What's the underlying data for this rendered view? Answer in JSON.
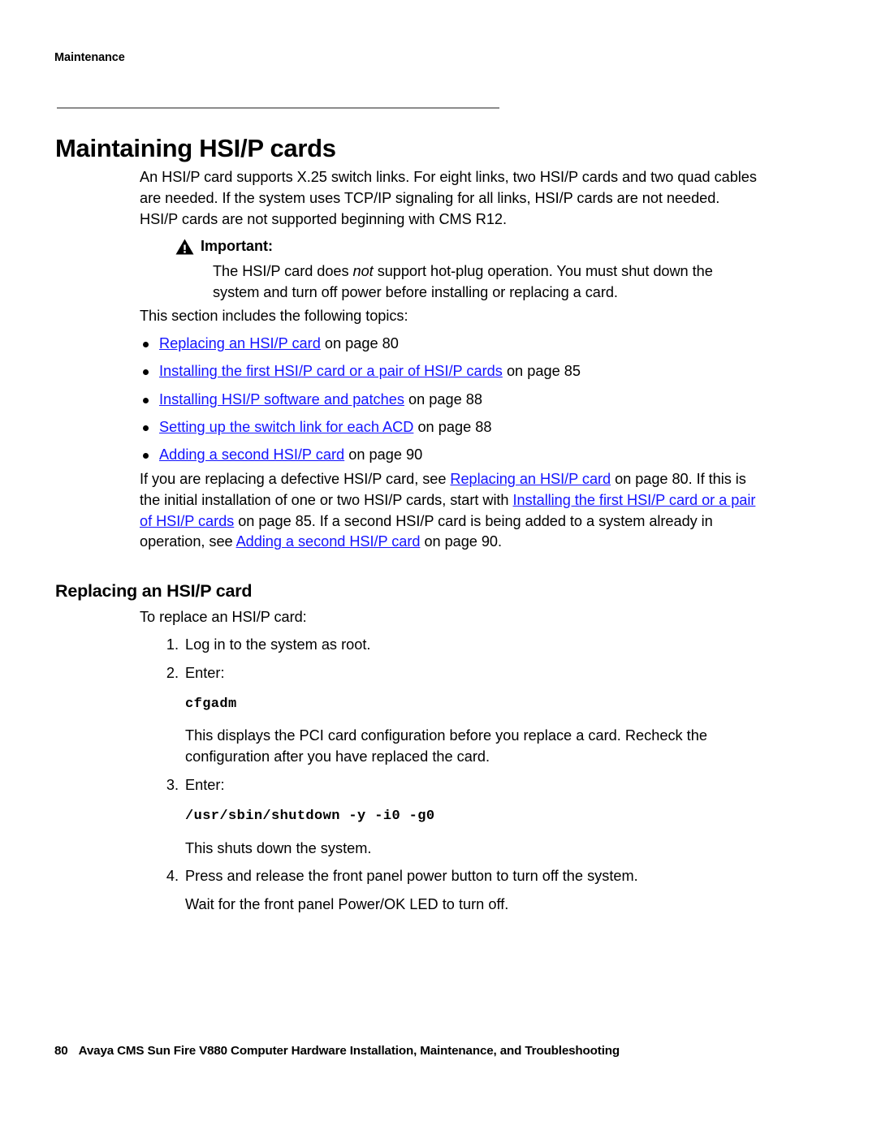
{
  "document": {
    "running_header": "Maintenance",
    "chapter_title": "Maintaining HSI/P cards",
    "footer": {
      "page_number": "80",
      "title": "Avaya CMS Sun Fire V880 Computer Hardware Installation, Maintenance, and Troubleshooting"
    }
  },
  "intro": {
    "paragraph": "An HSI/P card supports X.25 switch links. For eight links, two HSI/P cards and two quad cables are needed. If the system uses TCP/IP signaling for all links, HSI/P cards are not needed. HSI/P cards are not supported beginning with CMS R12."
  },
  "important": {
    "icon": "warning-triangle-icon",
    "label": "Important:",
    "text_before_emphasis": "The HSI/P card does ",
    "emphasis": "not",
    "text_after_emphasis": " support hot-plug operation. You must shut down the system and turn off power before installing or replacing a card."
  },
  "topics": {
    "lead_in": "This section includes the following topics:",
    "items": [
      {
        "link": "Replacing an HSI/P card",
        "suffix": " on page 80"
      },
      {
        "link": "Installing the first HSI/P card or a pair of HSI/P cards",
        "suffix": " on page 85"
      },
      {
        "link": "Installing HSI/P software and patches",
        "suffix": " on page 88"
      },
      {
        "link": "Setting up the switch link for each ACD",
        "suffix": " on page 88"
      },
      {
        "link": "Adding a second HSI/P card",
        "suffix": " on page 90"
      }
    ]
  },
  "guidance": {
    "seg1": "If you are replacing a defective HSI/P card, see ",
    "link1": "Replacing an HSI/P card",
    "seg2": " on page 80. If this is the initial installation of one or two HSI/P cards, start with ",
    "link2": "Installing the first HSI/P card or a pair of HSI/P cards",
    "seg3": " on page 85. If a second HSI/P card is being added to a system already in operation, see ",
    "link3": "Adding a second HSI/P card",
    "seg4": " on page 90."
  },
  "section": {
    "heading": "Replacing an HSI/P card",
    "lead_in": "To replace an HSI/P card:",
    "steps": [
      {
        "num": "1.",
        "text": "Log in to the system as root."
      },
      {
        "num": "2.",
        "text": "Enter:"
      },
      {
        "num": "3.",
        "text": "Enter:"
      },
      {
        "num": "4.",
        "text": "Press and release the front panel power button to turn off the system."
      }
    ],
    "command_1": "cfgadm",
    "after_command_1": "This displays the PCI card configuration before you replace a card. Recheck the configuration after you have replaced the card.",
    "command_2": "/usr/sbin/shutdown -y -i0 -g0",
    "after_command_2": "This shuts down the system.",
    "after_step_4": "Wait for the front panel Power/OK LED to turn off."
  },
  "colors": {
    "link": "#1414FF",
    "rule": "#8C8C8C",
    "text": "#000000"
  }
}
